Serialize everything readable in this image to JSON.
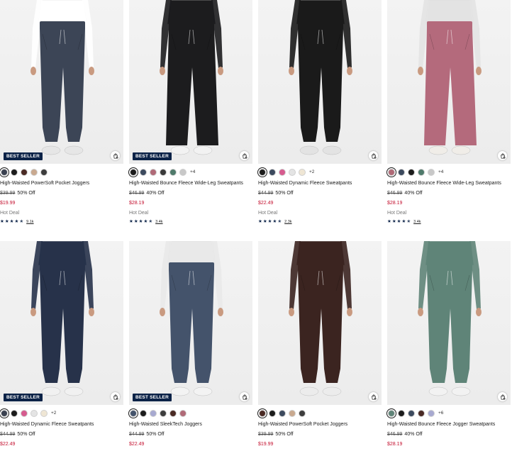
{
  "colors": {
    "badge_bg": "#0b2247",
    "sale_price": "#c41230",
    "star": "#0b2247"
  },
  "icons": {
    "bag": "add-to-bag-icon",
    "star": "star-icon"
  },
  "products": [
    {
      "name": "High-Waisted PowerSoft Pocket Joggers",
      "badge": "BEST SELLER",
      "garment_color": "#3c4556",
      "top_color": "#ffffff",
      "shoe_color": "#e6e6e6",
      "style": "jogger",
      "swatches": [
        "#3a4150",
        "#1c1c1c",
        "#4a2a24",
        "#c9a98f",
        "#3d3d3d"
      ],
      "more": "",
      "was_price": "$39.99",
      "percent_off": "50% Off",
      "price": "$19.99",
      "deal": "Hot Deal",
      "rating_count": "9.1k"
    },
    {
      "name": "High-Waisted Bounce Fleece Wide-Leg Sweatpants",
      "badge": "BEST SELLER",
      "garment_color": "#1c1c1e",
      "top_color": "#1c1c1e",
      "shoe_color": "#f2f2f2",
      "style": "wide",
      "swatches": [
        "#1c1c1c",
        "#3c4a5e",
        "#b06a77",
        "#3a3a3a",
        "#4f7a6b",
        "#c8c8c8"
      ],
      "more": "+4",
      "was_price": "$46.99",
      "percent_off": "40% Off",
      "price": "$28.19",
      "deal": "Hot Deal",
      "rating_count": "3.4k"
    },
    {
      "name": "High-Waisted Dynamic Fleece Sweatpants",
      "badge": "",
      "garment_color": "#1a1a1a",
      "top_color": "#1a1a1a",
      "shoe_color": "#e3e3e3",
      "style": "jogger",
      "swatches": [
        "#1c1c1c",
        "#3c4a5e",
        "#d65b8e",
        "#e4e4e4",
        "#efe6d4"
      ],
      "more": "+2",
      "was_price": "$44.99",
      "percent_off": "50% Off",
      "price": "$22.49",
      "deal": "Hot Deal",
      "rating_count": "2.3k"
    },
    {
      "name": "High-Waisted Bounce Fleece Wide-Leg Sweatpants",
      "badge": "",
      "garment_color": "#b46a7c",
      "top_color": "#e3e3e3",
      "shoe_color": "#f0ede8",
      "style": "wide",
      "swatches": [
        "#b06a77",
        "#3c4a5e",
        "#1c1c1c",
        "#4f7a6b",
        "#c8c8c8"
      ],
      "more": "+4",
      "was_price": "$46.99",
      "percent_off": "40% Off",
      "price": "$28.19",
      "deal": "Hot Deal",
      "rating_count": "3.4k"
    },
    {
      "name": "High-Waisted Dynamic Fleece Sweatpants",
      "badge": "BEST SELLER",
      "garment_color": "#27324a",
      "top_color": "#27324a",
      "shoe_color": "#f1f1f1",
      "style": "jogger",
      "swatches": [
        "#3a4150",
        "#1c1c1c",
        "#d65b8e",
        "#e4e4e4",
        "#efe6d4"
      ],
      "more": "+2",
      "was_price": "$44.99",
      "percent_off": "50% Off",
      "price": "$22.49",
      "deal": "",
      "rating_count": ""
    },
    {
      "name": "High-Waisted SleekTech Joggers",
      "badge": "BEST SELLER",
      "garment_color": "#44536b",
      "top_color": "#e9e9e9",
      "shoe_color": "#f3f3f3",
      "style": "jogger",
      "swatches": [
        "#44536b",
        "#1c1c1c",
        "#a7a9d0",
        "#3d3d3d",
        "#4a2a24",
        "#b06a77"
      ],
      "more": "",
      "was_price": "$44.99",
      "percent_off": "50% Off",
      "price": "$22.49",
      "deal": "",
      "rating_count": ""
    },
    {
      "name": "High-Waisted PowerSoft Pocket Joggers",
      "badge": "",
      "garment_color": "#3b2420",
      "top_color": "#3b2420",
      "shoe_color": "#ececec",
      "style": "jogger",
      "swatches": [
        "#4a2a24",
        "#1c1c1c",
        "#3c4a5e",
        "#c9a98f",
        "#3d3d3d"
      ],
      "more": "",
      "was_price": "$39.99",
      "percent_off": "50% Off",
      "price": "$19.99",
      "deal": "",
      "rating_count": ""
    },
    {
      "name": "High-Waisted Bounce Fleece Jogger Sweatpants",
      "badge": "",
      "garment_color": "#5f8478",
      "top_color": "#5f8478",
      "shoe_color": "#f2f2f2",
      "style": "jogger",
      "swatches": [
        "#5f8478",
        "#1c1c1c",
        "#3c4a5e",
        "#4a2a24",
        "#a7a9d0"
      ],
      "more": "+6",
      "was_price": "$46.99",
      "percent_off": "40% Off",
      "price": "$28.19",
      "deal": "",
      "rating_count": ""
    }
  ]
}
